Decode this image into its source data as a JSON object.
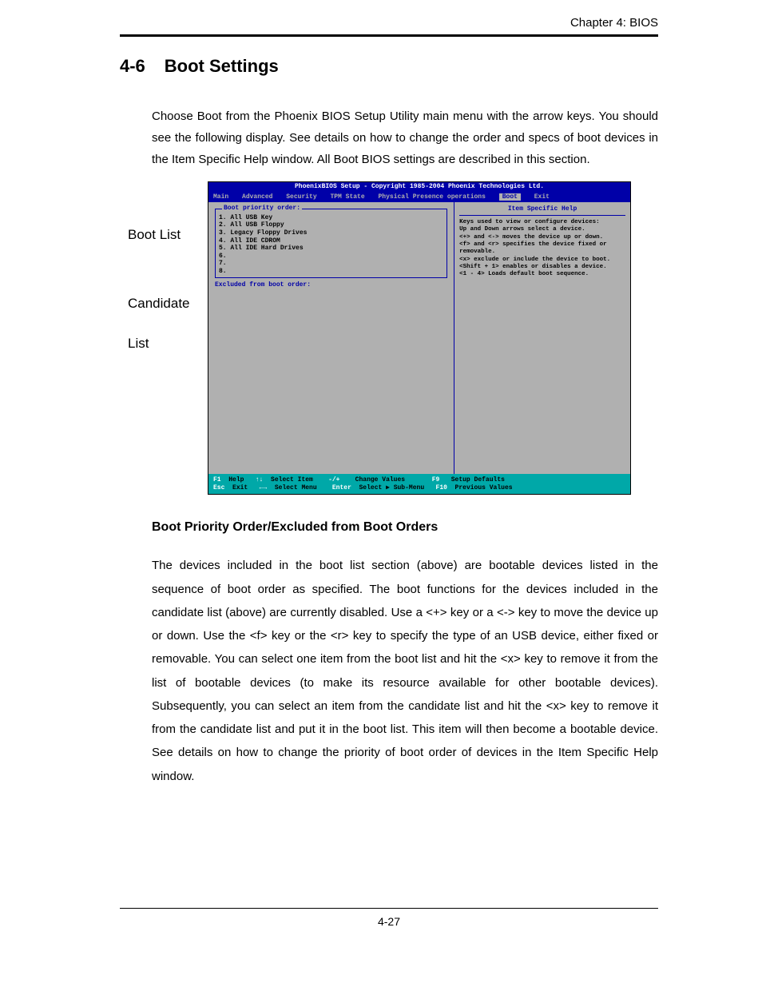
{
  "header": {
    "chapter": "Chapter 4: BIOS"
  },
  "section": {
    "number": "4-6",
    "title": "Boot Settings"
  },
  "intro": "Choose Boot from the Phoenix BIOS Setup Utility main menu with the arrow keys. You should see the following display. See details on how to change the order and specs of boot devices in the Item Specific Help window. All Boot BIOS settings are described in this section.",
  "side_labels": {
    "boot_list": "Boot List",
    "candidate": "Candidate",
    "list": "List"
  },
  "bios": {
    "title": "PhoenixBIOS Setup - Copyright 1985-2004 Phoenix Technologies Ltd.",
    "menu": {
      "main": "Main",
      "advanced": "Advanced",
      "security": "Security",
      "tpm": "TPM State",
      "ppo": "Physical Presence operations",
      "boot": "Boot",
      "exit": "Exit"
    },
    "left": {
      "priority_label": "Boot priority order:",
      "items": [
        "1. All USB Key",
        "2. All USB Floppy",
        "3. Legacy Floppy Drives",
        "4. All IDE CDROM",
        "5. All IDE Hard Drives",
        "6.",
        "7.",
        "8."
      ],
      "excluded_label": "Excluded from boot order:"
    },
    "right": {
      "title": "Item Specific Help",
      "help": "Keys used to view or configure devices:\nUp and Down arrows select a device.\n<+> and <-> moves the device up or down.\n<f> and <r> specifies the device fixed or removable.\n<x> exclude or include the device to boot.\n<Shift + 1> enables or disables a device.\n<1 - 4> Loads default boot sequence."
    },
    "footer": {
      "line1": {
        "f1": "F1",
        "help": "Help",
        "arrows1": "↑↓",
        "sel_item": "Select Item",
        "pm": "-/+",
        "chval": "Change Values",
        "f9": "F9",
        "defaults": "Setup Defaults"
      },
      "line2": {
        "esc": "Esc",
        "exit": "Exit",
        "arrows2": "←→",
        "sel_menu": "Select Menu",
        "enter": "Enter",
        "sub": "Select ▶ Sub-Menu",
        "f10": "F10",
        "prev": "Previous Values"
      }
    }
  },
  "subheading": "Boot Priority Order/Excluded from Boot Orders",
  "body": "The devices included in the boot list section (above) are bootable devices listed in the sequence of boot order as specified. The boot functions for the devices included in the candidate list (above) are currently disabled.  Use a <+> key or a <-> key to move the device up or down. Use the <f> key or the <r> key to specify the type of an USB device, either fixed or removable. You can select one item from the boot list and hit the <x> key to remove it from the list of bootable devices (to make its resource available for other bootable devices). Subsequently, you can select an item from the candidate list and hit the <x> key  to remove it from the candidate list and put it in the boot list. This item will then become a bootable device. See details on how to change the priority of boot order of devices in the Item Specific Help window.",
  "page_number": "4-27"
}
